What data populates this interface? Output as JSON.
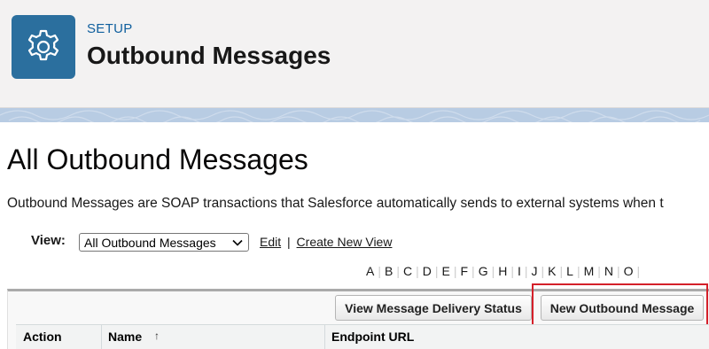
{
  "header": {
    "eyebrow": "SETUP",
    "title": "Outbound Messages",
    "icon": "gear-icon",
    "icon_color": "#2b6f9e"
  },
  "page": {
    "title": "All Outbound Messages",
    "description": "Outbound Messages are SOAP transactions that Salesforce automatically sends to external systems when t"
  },
  "view": {
    "label": "View:",
    "selected": "All Outbound Messages",
    "edit_link": "Edit",
    "separator": "|",
    "create_link": "Create New View"
  },
  "alphabet": [
    "A",
    "B",
    "C",
    "D",
    "E",
    "F",
    "G",
    "H",
    "I",
    "J",
    "K",
    "L",
    "M",
    "N",
    "O"
  ],
  "buttons": {
    "delivery_status": "View Message Delivery Status",
    "new_message": "New Outbound Message"
  },
  "table": {
    "columns": [
      "Action",
      "Name",
      "Endpoint URL"
    ],
    "sort_indicator": "↑"
  },
  "colors": {
    "highlight": "#d4202a",
    "link": "#0f5f9e"
  }
}
